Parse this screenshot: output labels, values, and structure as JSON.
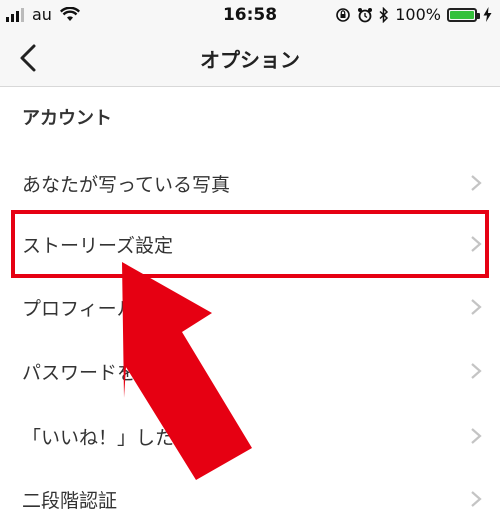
{
  "status_bar": {
    "carrier": "au",
    "time": "16:58",
    "battery_percent": "100%",
    "battery_level": 1.0,
    "battery_color": "#34c13b"
  },
  "nav": {
    "title": "オプション"
  },
  "section": {
    "account_header": "アカウント"
  },
  "menu_items": [
    {
      "label": "あなたが写っている写真"
    },
    {
      "label": "ストーリーズ設定"
    },
    {
      "label": "プロフィールを編集"
    },
    {
      "label": "パスワードを変更"
    },
    {
      "label": "「いいね！」した投稿"
    },
    {
      "label": "二段階認証"
    }
  ],
  "annotation": {
    "highlight_color": "#e60012",
    "highlighted_item": "ストーリーズ設定"
  }
}
